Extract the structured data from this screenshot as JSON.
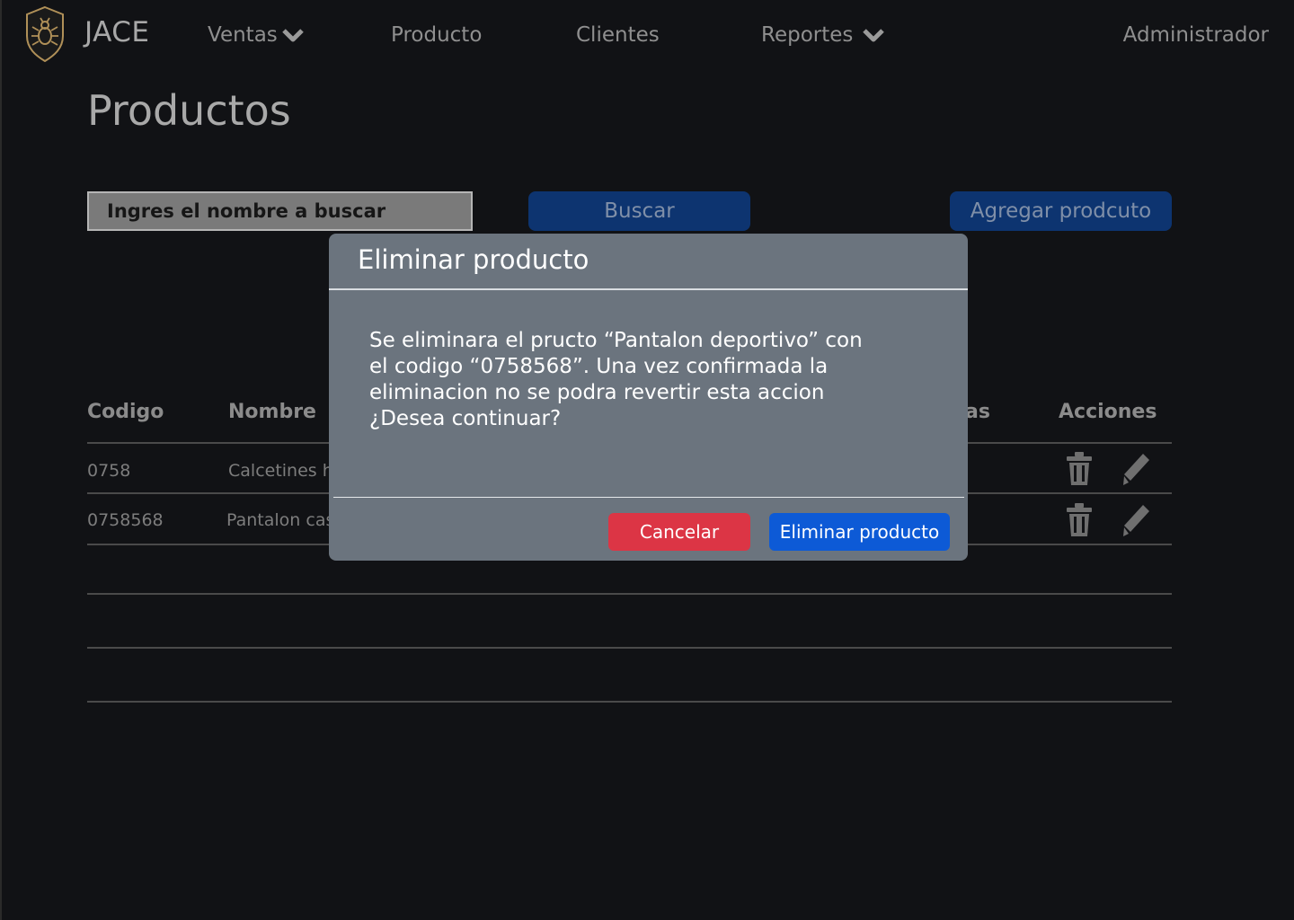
{
  "nav": {
    "brand": "JACE",
    "items": [
      {
        "label": "Ventas",
        "has_dropdown": true
      },
      {
        "label": "Producto",
        "has_dropdown": false
      },
      {
        "label": "Clientes",
        "has_dropdown": false
      },
      {
        "label": "Reportes",
        "has_dropdown": true
      }
    ],
    "user": "Administrador"
  },
  "page": {
    "title": "Productos",
    "search_placeholder": "Ingres el nombre a buscar",
    "search_button": "Buscar",
    "add_button": "Agregar prodcuto"
  },
  "table": {
    "headers": {
      "code": "Codigo",
      "name": "Nombre",
      "hidden_col_tail": "as",
      "actions": "Acciones"
    },
    "rows": [
      {
        "code": "0758",
        "name": "Calcetines h"
      },
      {
        "code": "0758568",
        "name": "Pantalon cas"
      }
    ]
  },
  "modal": {
    "title": "Eliminar producto",
    "message": "Se eliminara el pructo “Pantalon deportivo” con el codigo “0758568”. Una vez confirmada la eliminacion no se podra revertir esta accion ¿Desea continuar?",
    "cancel": "Cancelar",
    "confirm": "Eliminar producto"
  },
  "colors": {
    "background": "#111215",
    "modal": "#6b747e",
    "danger": "#dc3545",
    "primary": "#0d5ad6",
    "primary_dim": "#0d3470"
  },
  "icons": [
    "bug-shield-logo-icon",
    "chevron-down-icon",
    "trash-icon",
    "pencil-icon"
  ]
}
